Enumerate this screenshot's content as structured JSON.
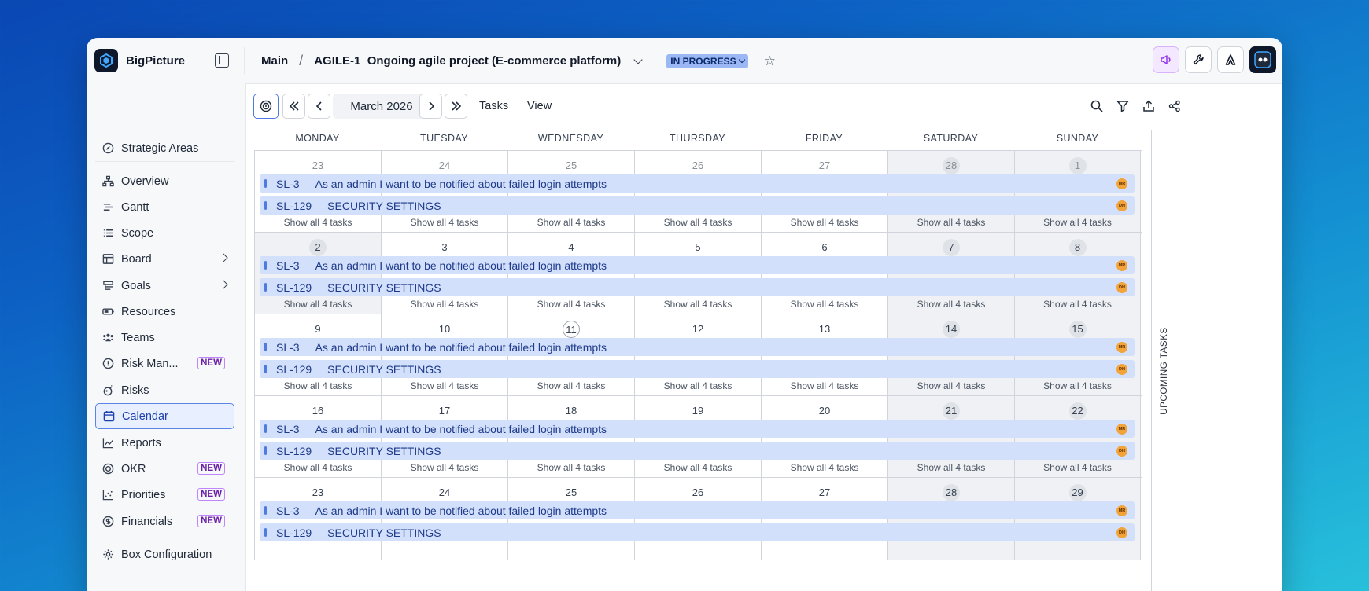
{
  "app": {
    "name": "BigPicture"
  },
  "breadcrumb": {
    "root": "Main",
    "separator": "/",
    "project": "AGILE-1  Ongoing agile project (E-commerce platform)"
  },
  "status": {
    "label": "IN PROGRESS",
    "color": "#9bb8f4"
  },
  "sidebar": {
    "items": [
      {
        "label": "Strategic Areas",
        "icon": "compass-icon"
      },
      {
        "label": "Overview",
        "icon": "hierarchy-icon"
      },
      {
        "label": "Gantt",
        "icon": "gantt-icon"
      },
      {
        "label": "Scope",
        "icon": "list-icon"
      },
      {
        "label": "Board",
        "icon": "board-icon"
      },
      {
        "label": "Goals",
        "icon": "goals-icon"
      },
      {
        "label": "Resources",
        "icon": "battery-icon"
      },
      {
        "label": "Teams",
        "icon": "teams-icon"
      },
      {
        "label": "Risk Man...",
        "icon": "risk-icon",
        "badge": "NEW"
      },
      {
        "label": "Risks",
        "icon": "bomb-icon"
      },
      {
        "label": "Calendar",
        "icon": "calendar-icon"
      },
      {
        "label": "Reports",
        "icon": "chart-icon"
      },
      {
        "label": "OKR",
        "icon": "target-icon",
        "badge": "NEW"
      },
      {
        "label": "Priorities",
        "icon": "scatter-icon",
        "badge": "NEW"
      },
      {
        "label": "Financials",
        "icon": "dollar-icon",
        "badge": "NEW"
      },
      {
        "label": "Box Configuration",
        "icon": "gear-icon"
      }
    ]
  },
  "toolbar": {
    "month": "March 2026",
    "tasks_label": "Tasks",
    "view_label": "View"
  },
  "calendar": {
    "day_headers": [
      "MONDAY",
      "TUESDAY",
      "WEDNESDAY",
      "THURSDAY",
      "FRIDAY",
      "SATURDAY",
      "SUNDAY"
    ],
    "show_all_label": "Show all 4 tasks",
    "tasks": [
      {
        "key": "SL-3",
        "title": "As an admin I want to be notified about failed login attempts",
        "assignee": "MR"
      },
      {
        "key": "SL-129",
        "title": "SECURITY SETTINGS",
        "assignee": "DH"
      }
    ],
    "weeks": [
      [
        "23",
        "24",
        "25",
        "26",
        "27",
        "28",
        "1"
      ],
      [
        "2",
        "3",
        "4",
        "5",
        "6",
        "7",
        "8"
      ],
      [
        "9",
        "10",
        "11",
        "12",
        "13",
        "14",
        "15"
      ],
      [
        "16",
        "17",
        "18",
        "19",
        "20",
        "21",
        "22"
      ],
      [
        "23",
        "24",
        "25",
        "26",
        "27",
        "28",
        "29"
      ]
    ],
    "today": "11"
  },
  "upcoming": {
    "label": "UPCOMING TASKS"
  },
  "colors": {
    "accent": "#4f7be0",
    "task_bar": "#d3e0fb",
    "avatar": "#f2a33a"
  }
}
